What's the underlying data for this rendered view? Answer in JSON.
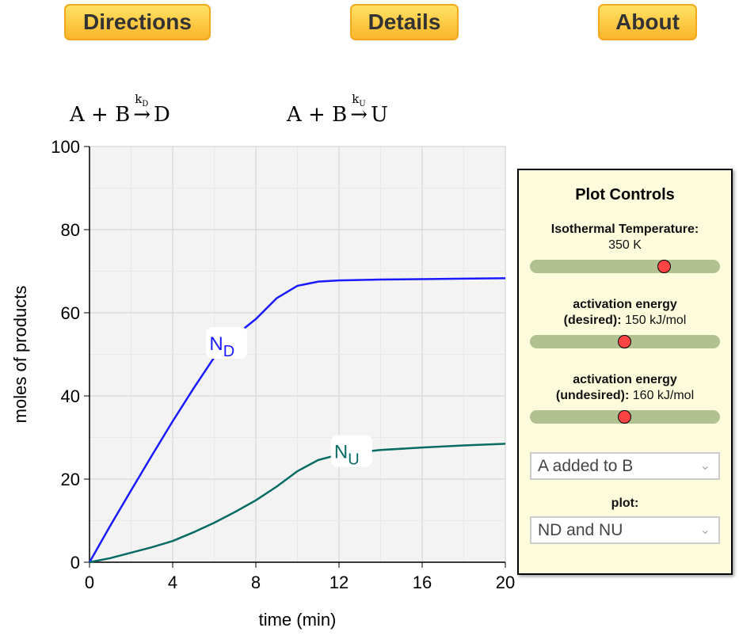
{
  "nav": {
    "directions": "Directions",
    "details": "Details",
    "about": "About"
  },
  "equations": [
    {
      "lhs": "A + B",
      "k": "k",
      "sub": "D",
      "arrow": "→",
      "product": "D"
    },
    {
      "lhs": "A + B",
      "k": "k",
      "sub": "U",
      "arrow": "→",
      "product": "U"
    }
  ],
  "chart_data": {
    "type": "line",
    "xlabel": "time (min)",
    "ylabel": "moles of products",
    "xlim": [
      0,
      20
    ],
    "ylim": [
      0,
      100
    ],
    "xticks": [
      0,
      4,
      8,
      12,
      16,
      20
    ],
    "yticks": [
      0,
      20,
      40,
      60,
      80,
      100
    ],
    "grid": true,
    "series": [
      {
        "name": "ND",
        "label_main": "N",
        "label_sub": "D",
        "color": "#1a1aff",
        "label_at": [
          6.6,
          52
        ],
        "x": [
          0,
          1,
          2,
          3,
          4,
          5,
          6,
          7,
          8,
          9,
          10,
          11,
          12,
          14,
          16,
          18,
          20
        ],
        "y": [
          0,
          8.8,
          17.3,
          25.7,
          33.9,
          41.8,
          49.3,
          54.5,
          58.5,
          63.5,
          66.5,
          67.5,
          67.8,
          68.0,
          68.1,
          68.2,
          68.3
        ]
      },
      {
        "name": "NU",
        "label_main": "N",
        "label_sub": "U",
        "color": "#066b63",
        "label_at": [
          12.6,
          26
        ],
        "x": [
          0,
          1,
          2,
          3,
          4,
          5,
          6,
          7,
          8,
          9,
          10,
          11,
          12,
          13,
          14,
          16,
          18,
          20
        ],
        "y": [
          0,
          1.0,
          2.3,
          3.6,
          5.1,
          7.2,
          9.5,
          12.1,
          14.9,
          18.2,
          21.9,
          24.6,
          25.9,
          26.5,
          27.0,
          27.6,
          28.1,
          28.5
        ]
      }
    ]
  },
  "controls": {
    "title": "Plot Controls",
    "temperature": {
      "label": "Isothermal Temperature:",
      "value": "350 K",
      "fraction": 0.71
    },
    "ea_desired": {
      "label1": "activation energy",
      "label2": "(desired):",
      "value": "150 kJ/mol",
      "fraction": 0.5
    },
    "ea_undesired": {
      "label1": "activation energy",
      "label2": "(undesired):",
      "value": "160 kJ/mol",
      "fraction": 0.5
    },
    "mode_select": "A added to B",
    "plot_label": "plot:",
    "plot_select": "ND and NU"
  }
}
